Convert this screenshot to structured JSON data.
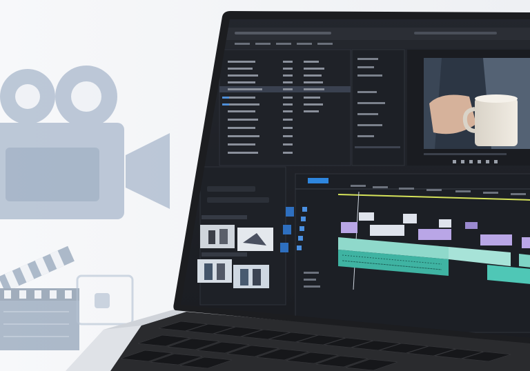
{
  "scene": {
    "background_color": "#f4f5f7",
    "illustration_color": "#a9b8cc",
    "laptop_bezel_color": "#1c1d20",
    "keyboard_color": "#2a2b2e",
    "editor_panel_color": "#1f2228",
    "accent_blue": "#2e86de",
    "clip_purple": "#b9a6e6",
    "clip_teal": "#4fc7b6",
    "icons": [
      "film-camera-icon",
      "clapperboard-icon",
      "film-strip-icon",
      "coffee-mug-hand-image",
      "clip-thumbnail-image"
    ]
  }
}
